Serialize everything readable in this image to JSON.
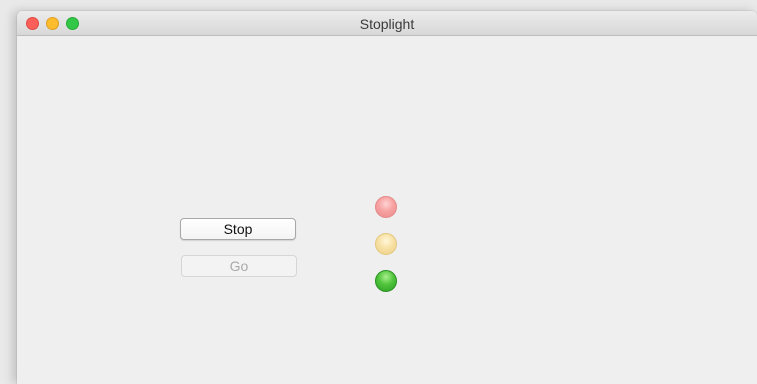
{
  "window": {
    "title": "Stoplight"
  },
  "buttons": {
    "stop_label": "Stop",
    "go_label": "Go",
    "go_enabled": false
  },
  "lights": {
    "red": {
      "color": "#f7a2a2",
      "lit": false
    },
    "yellow": {
      "color": "#f8e1a5",
      "lit": false
    },
    "green": {
      "color": "#4fc43a",
      "lit": true
    }
  },
  "window_controls": {
    "close_color": "#fc5f57",
    "minimize_color": "#fdbc2e",
    "zoom_color": "#33c748"
  }
}
